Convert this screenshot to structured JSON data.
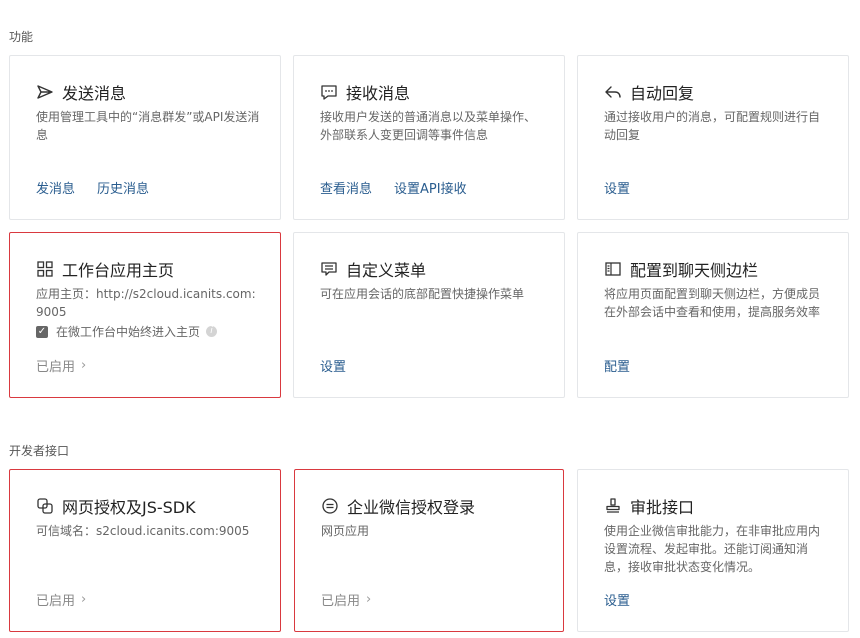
{
  "sections": {
    "features": "功能",
    "developer": "开发者接口"
  },
  "cards": {
    "send": {
      "title": "发送消息",
      "desc": "使用管理工具中的“消息群发”或API发送消息",
      "links": [
        "发消息",
        "历史消息"
      ],
      "icon": "send-icon"
    },
    "receive": {
      "title": "接收消息",
      "desc": "接收用户发送的普通消息以及菜单操作、外部联系人变更回调等事件信息",
      "links": [
        "查看消息",
        "设置API接收"
      ],
      "icon": "chat-bubble-icon"
    },
    "autoreply": {
      "title": "自动回复",
      "desc": "通过接收用户的消息，可配置规则进行自动回复",
      "links": [
        "设置"
      ],
      "icon": "reply-icon"
    },
    "workbench": {
      "title": "工作台应用主页",
      "desc": "应用主页：http://s2cloud.icanits.com:9005",
      "checkbox_label": "在微工作台中始终进入主页",
      "checkbox_checked": true,
      "status": "已启用",
      "icon": "grid-icon"
    },
    "menu": {
      "title": "自定义菜单",
      "desc": "可在应用会话的底部配置快捷操作菜单",
      "links": [
        "设置"
      ],
      "icon": "menu-icon"
    },
    "sidebar": {
      "title": "配置到聊天侧边栏",
      "desc": "将应用页面配置到聊天侧边栏，方便成员在外部会话中查看和使用，提高服务效率",
      "links": [
        "配置"
      ],
      "icon": "sidebar-icon"
    },
    "oauth": {
      "title": "网页授权及JS-SDK",
      "desc": "可信域名：s2cloud.icanits.com:9005",
      "status": "已启用",
      "icon": "copy-link-icon"
    },
    "wecomlogin": {
      "title": "企业微信授权登录",
      "desc": "网页应用",
      "status": "已启用",
      "icon": "login-icon"
    },
    "approval": {
      "title": "审批接口",
      "desc": "使用企业微信审批能力，在非审批应用内设置流程、发起审批。还能订阅通知消息，接收审批状态变化情况。",
      "links": [
        "设置"
      ],
      "icon": "stamp-icon"
    }
  },
  "colors": {
    "highlight_border": "#d9393f",
    "link": "#2a5d8f"
  }
}
